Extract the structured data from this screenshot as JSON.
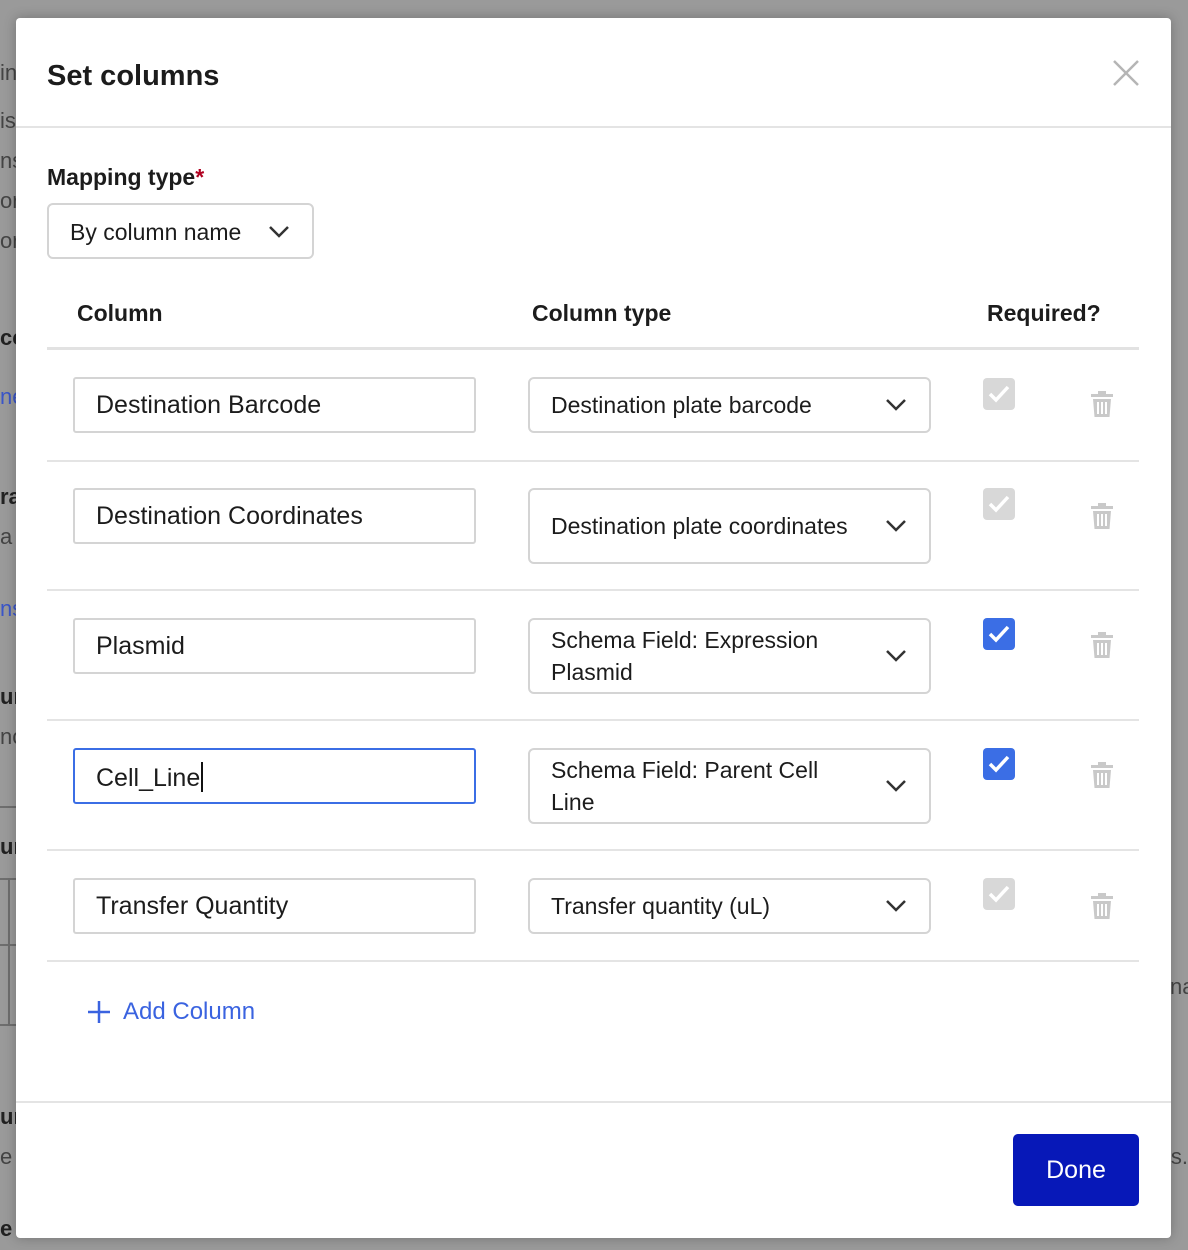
{
  "background": {
    "left_fragments": [
      {
        "text": "in",
        "style": ""
      },
      {
        "text": "is",
        "style": ""
      },
      {
        "text": "ns",
        "style": ""
      },
      {
        "text": "or",
        "style": ""
      },
      {
        "text": "or",
        "style": ""
      },
      {
        "text": "cc",
        "style": "bold"
      },
      {
        "text": "ne",
        "style": "blue"
      },
      {
        "text": "ra",
        "style": "bold"
      },
      {
        "text": "a",
        "style": ""
      },
      {
        "text": "ns",
        "style": "blue"
      },
      {
        "text": "ur",
        "style": "bold"
      },
      {
        "text": "nc",
        "style": ""
      },
      {
        "text": "ur",
        "style": "bold"
      },
      {
        "text": "ur",
        "style": "bold"
      },
      {
        "text": "e",
        "style": ""
      },
      {
        "text": "e",
        "style": "bold"
      }
    ],
    "right_fragments": [
      "na",
      "s."
    ]
  },
  "modal": {
    "title": "Set columns",
    "mapping_label": "Mapping type",
    "mapping_required_mark": "*",
    "mapping_value": "By column name",
    "headers": {
      "column": "Column",
      "column_type": "Column type",
      "required": "Required?"
    },
    "rows": [
      {
        "name": "Destination Barcode",
        "type": "Destination plate barcode",
        "required": true,
        "editable": false,
        "focused": false
      },
      {
        "name": "Destination Coordinates",
        "type": "Destination plate coordinates",
        "required": true,
        "editable": false,
        "focused": false
      },
      {
        "name": "Plasmid",
        "type": "Schema Field: Expression Plasmid",
        "required": true,
        "editable": true,
        "focused": false
      },
      {
        "name": "Cell_Line",
        "type": "Schema Field: Parent Cell Line",
        "required": true,
        "editable": true,
        "focused": true
      },
      {
        "name": "Transfer Quantity",
        "type": "Transfer quantity (uL)",
        "required": true,
        "editable": false,
        "focused": false
      }
    ],
    "add_column_label": "Add Column",
    "done_label": "Done"
  },
  "colors": {
    "primary_button": "#0718b8",
    "checkbox_active": "#3b6ee5",
    "checkbox_disabled": "#d8d8d8",
    "link": "#3a63e0",
    "required_star": "#b00020"
  }
}
